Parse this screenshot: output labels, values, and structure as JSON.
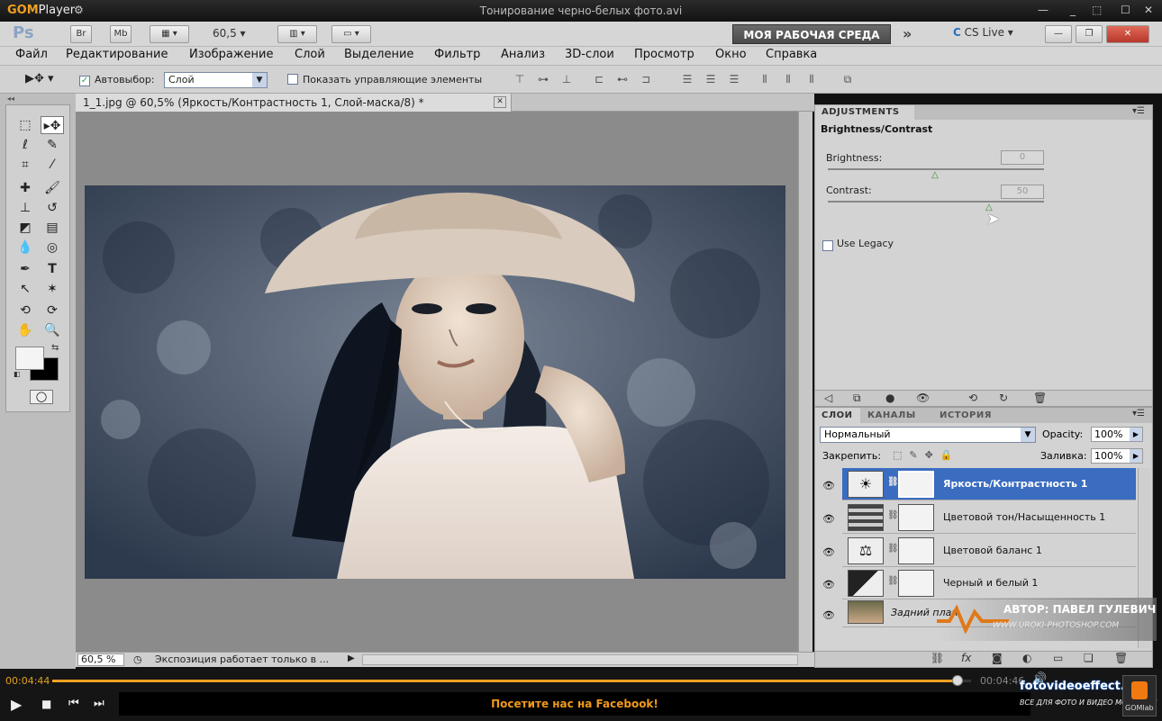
{
  "gom": {
    "logo": "GOM",
    "logo_suffix": "Player",
    "title": "Тонирование черно-белых фото.avi",
    "time_current": "00:04:44",
    "time_total": "00:04:46",
    "ticker": "Посетите нас на Facebook!",
    "progress_fraction": 0.985
  },
  "ps": {
    "logo": "Ps",
    "br": "Br",
    "mb": "Mb",
    "zoom": "60,5",
    "workspace": "МОЯ РАБОЧАЯ СРЕДА",
    "cslive": "CS Live"
  },
  "menu": [
    "Файл",
    "Редактирование",
    "Изображение",
    "Слой",
    "Выделение",
    "Фильтр",
    "Анализ",
    "3D-слои",
    "Просмотр",
    "Окно",
    "Справка"
  ],
  "options": {
    "autoselect": "Автовыбор:",
    "layer_select": "Слой",
    "show_controls": "Показать управляющие элементы"
  },
  "document": {
    "tab": "1_1.jpg @ 60,5% (Яркость/Контрастность 1, Слой-маска/8) *",
    "status_zoom": "60,5 %",
    "status_text": "Экспозиция работает только в ..."
  },
  "adjustments": {
    "tab": "ADJUSTMENTS",
    "title": "Brightness/Contrast",
    "brightness_label": "Brightness:",
    "brightness_value": "0",
    "contrast_label": "Contrast:",
    "contrast_value": "50",
    "brightness_slider": 0.5,
    "contrast_slider": 0.75,
    "legacy": "Use Legacy"
  },
  "layers_panel": {
    "tabs": [
      "СЛОИ",
      "КАНАЛЫ",
      "ИСТОРИЯ"
    ],
    "blend_mode": "Нормальный",
    "opacity_label": "Opacity:",
    "opacity": "100%",
    "lock_label": "Закрепить:",
    "fill_label": "Заливка:",
    "fill": "100%",
    "layers": [
      {
        "name": "Яркость/Контрастность 1",
        "selected": true,
        "icon": "brightness-icon"
      },
      {
        "name": "Цветовой тон/Насыщенность 1",
        "selected": false,
        "icon": "hue-icon"
      },
      {
        "name": "Цветовой баланс 1",
        "selected": false,
        "icon": "balance-icon"
      },
      {
        "name": "Черный и белый 1",
        "selected": false,
        "icon": "bw-icon"
      },
      {
        "name": "Задний план",
        "selected": false,
        "icon": "photo-thumb"
      }
    ]
  },
  "watermark": {
    "author": "АВТОР: ПАВЕЛ ГУЛЕВИЧ",
    "site": "WWW.UROKI-PHOTOSHOP.COM",
    "brand": "fotovideoeffect.com",
    "tagline": "ВСЕ ДЛЯ ФОТО И ВИДЕО МОНТАЖА!",
    "gomlab": "GOMlab"
  },
  "colors": {
    "accent": "#f0a020",
    "selected_layer": "#3a6cc0"
  }
}
